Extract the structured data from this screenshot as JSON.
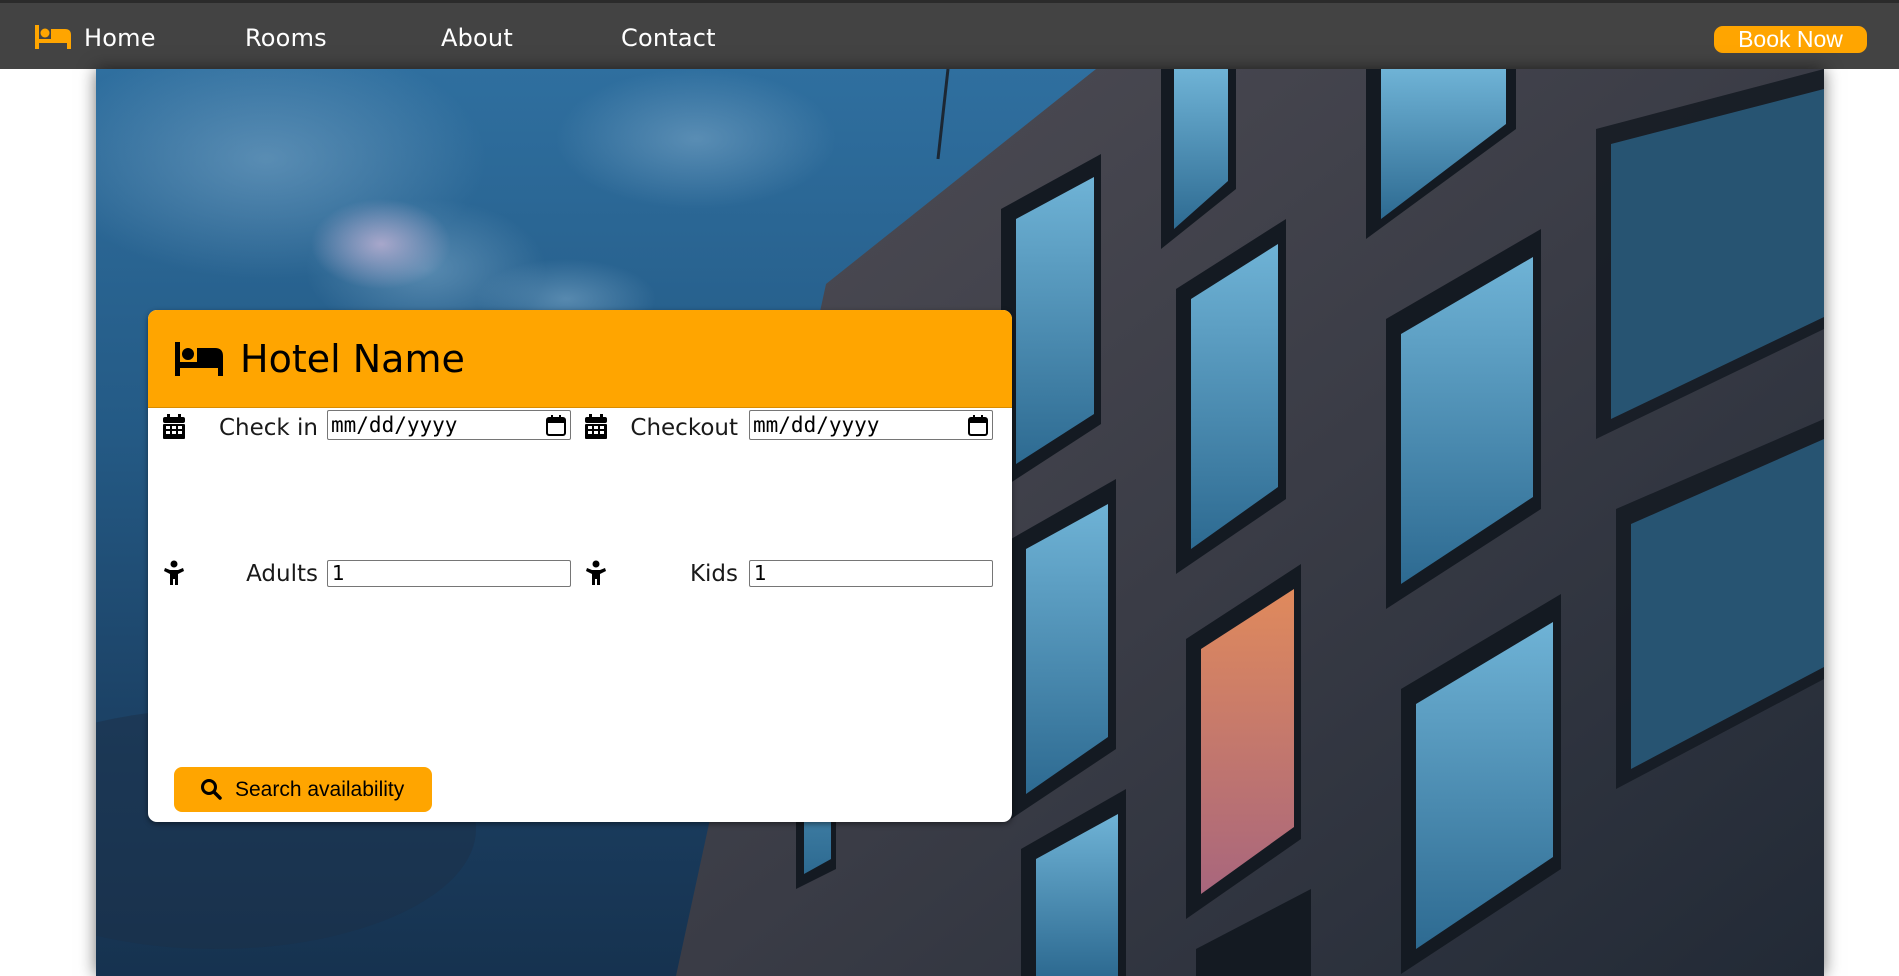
{
  "navbar": {
    "brand_icon": "bed-icon",
    "links": [
      {
        "label": "Home"
      },
      {
        "label": "Rooms"
      },
      {
        "label": "About"
      },
      {
        "label": "Contact"
      }
    ],
    "book_label": "Book Now"
  },
  "card": {
    "title": "Hotel Name",
    "title_icon": "bed-icon",
    "fields": {
      "check_in": {
        "label": "Check in",
        "value": "mm/dd/yyyy",
        "icon": "calendar-icon"
      },
      "checkout": {
        "label": "Checkout",
        "value": "mm/dd/yyyy",
        "icon": "calendar-icon"
      },
      "adults": {
        "label": "Adults",
        "value": "1",
        "icon": "child-icon"
      },
      "kids": {
        "label": "Kids",
        "value": "1",
        "icon": "child-icon"
      }
    },
    "search_label": "Search availability",
    "search_icon": "search-icon"
  },
  "colors": {
    "accent": "#ffa500",
    "navbar_bg": "#434343",
    "nav_text": "#ffffff"
  }
}
